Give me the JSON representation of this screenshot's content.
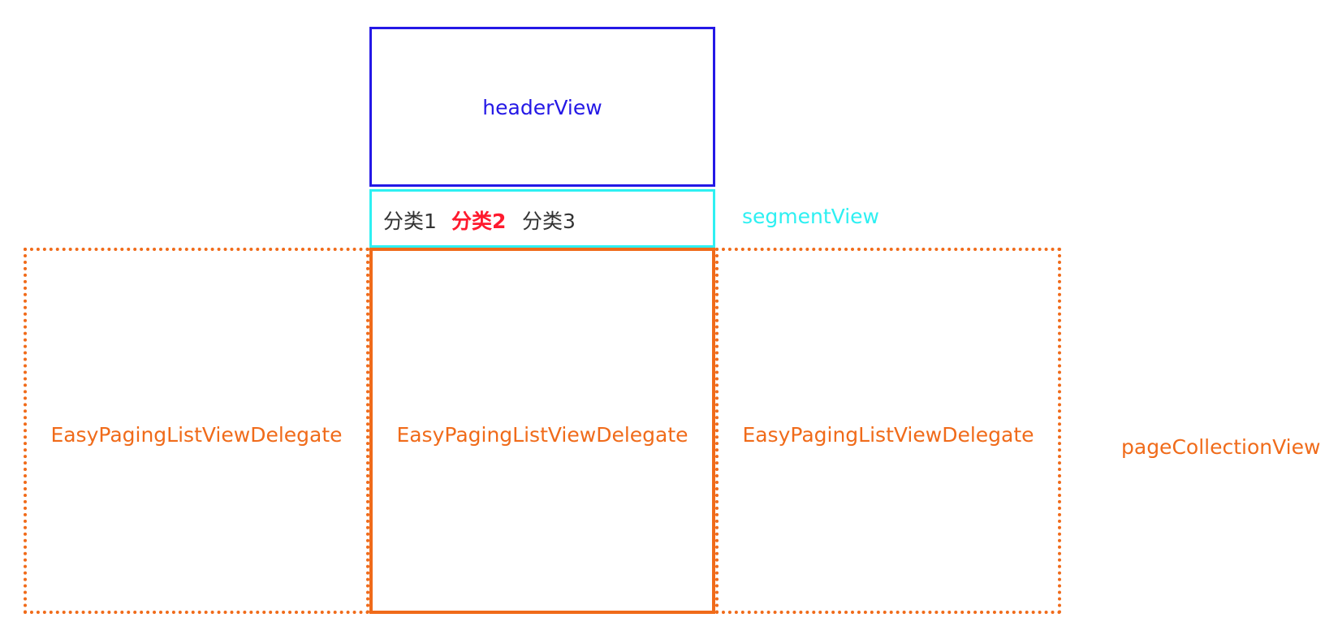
{
  "colors": {
    "header": "#2418e6",
    "segment": "#2ef0f2",
    "page": "#f06b1a",
    "tab_normal": "#333333",
    "tab_selected": "#ff1a2e"
  },
  "header_view": {
    "label": "headerView"
  },
  "segment_view": {
    "caption": "segmentView",
    "tabs": [
      {
        "label": "分类1",
        "selected": false
      },
      {
        "label": "分类2",
        "selected": true
      },
      {
        "label": "分类3",
        "selected": false
      }
    ]
  },
  "page_collection_view": {
    "caption": "pageCollectionView",
    "pages": [
      {
        "label": "EasyPagingListViewDelegate"
      },
      {
        "label": "EasyPagingListViewDelegate"
      },
      {
        "label": "EasyPagingListViewDelegate"
      }
    ]
  }
}
